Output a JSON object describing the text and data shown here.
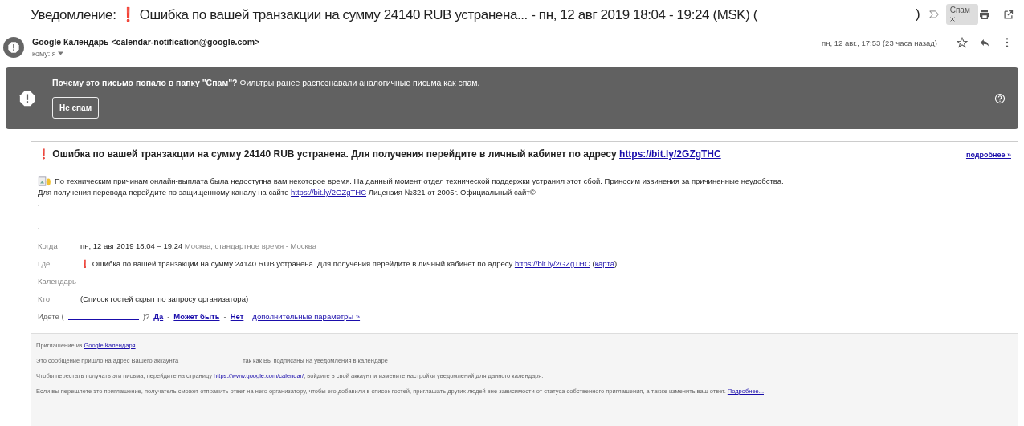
{
  "subject": {
    "text": "Уведомление: ❗ Ошибка по вашей транзакции на сумму 24140 RUB устранена... - пн, 12 авг 2019 18:04 - 19:24 (MSK) (",
    "closing": ")",
    "label": "Спам"
  },
  "sender": {
    "name": "Google Календарь <calendar-notification@google.com>",
    "to": "кому: я",
    "date": "пн, 12 авг., 17:53 (23 часа назад)"
  },
  "spam_banner": {
    "question": "Почему это письмо попало в папку \"Спам\"?",
    "explanation": "Фильтры ранее распознавали аналогичные письма как спам.",
    "button": "Не спам"
  },
  "event": {
    "heading": "❗ Ошибка по вашей транзакции на сумму 24140 RUB устранена. Для получения перейдите в личный кабинет по адресу",
    "heading_link": "https://bit.ly/2GZgTHC",
    "more": "подробнее »",
    "dots_top": [
      "."
    ],
    "line_1": "По техническим причинам онлайн-выплата была недоступна вам некоторое время. На данный момент отдел технической поддержки устранил этот сбой. Приносим извинения за причиненные неудобства.",
    "line_2_before": "Для получения перевода перейдите по защищенному каналу на сайте",
    "line_2_link": "https://bit.ly/2GZgTHC",
    "line_2_after": "Лицензия №321 от 2005г. Официальный сайт©",
    "dots_bottom": [
      ".",
      ".",
      "."
    ],
    "details": [
      {
        "label": "Когда",
        "value": "пн, 12 авг 2019 18:04 – 19:24",
        "note": "Москва, стандартное время - Москва"
      },
      {
        "label": "Где",
        "value": "❗ Ошибка по вашей транзакции на сумму 24140 RUB устранена. Для получения перейдите в личный кабинет по адресу",
        "link": "https://bit.ly/2GZgTHC",
        "map_open": "(",
        "map": "карта",
        "map_close": ")"
      },
      {
        "label": "Календарь"
      },
      {
        "label": "Кто",
        "value": "(Список гостей скрыт по запросу организатора)"
      }
    ],
    "rsvp": {
      "prompt": "Идете (",
      "prompt_end": ")?",
      "options": [
        "Да",
        "Может быть",
        "Нет"
      ],
      "separator": "-",
      "more": "дополнительные параметры »"
    }
  },
  "footer": {
    "invite": "Приглашение из",
    "invite_link": "Google Календаря",
    "account_before": "Это сообщение пришло на адрес Вашего аккаунта",
    "account_after": "так как Вы подписаны на уведомления в календаре",
    "unsubscribe_before": "Чтобы перестать получать эти письма, перейдите на страницу",
    "unsubscribe_link": "https://www.google.com/calendar/",
    "unsubscribe_after": ", войдите в свой аккаунт и измените настройки уведомлений для данного календаря.",
    "forward": "Если вы перешлете это приглашение, получатель сможет отправить ответ на него организатору, чтобы его добавили в список гостей, приглашать других людей вне зависимости от статуса собственного приглашения, а также изменить ваш ответ.",
    "forward_link": "Подробнее..."
  }
}
